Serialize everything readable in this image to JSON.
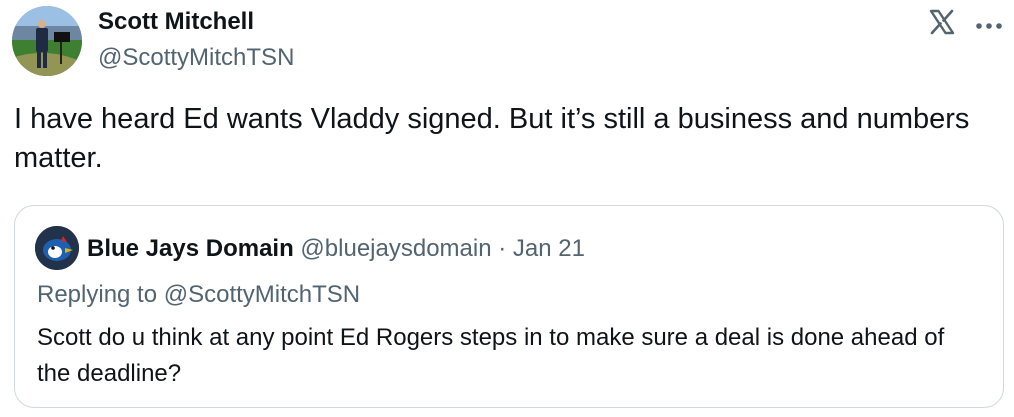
{
  "tweet": {
    "author_name": "Scott Mitchell",
    "author_handle": "@ScottyMitchTSN",
    "text": "I have heard Ed wants Vladdy signed. But it’s still a business and numbers matter.",
    "icons": [
      "avatar",
      "x-logo-icon",
      "more-options-icon"
    ]
  },
  "quote": {
    "author_name": "Blue Jays Domain",
    "author_handle": "@bluejaysdomain",
    "separator": "·",
    "date": "Jan 21",
    "replying_to": "Replying to @ScottyMitchTSN",
    "text": "Scott do u think at any point Ed Rogers steps in to make sure a deal is done ahead of the deadline?",
    "icons": [
      "quote-avatar"
    ]
  },
  "colors": {
    "text_primary": "#0f1419",
    "text_secondary": "#536471",
    "border": "#cfd9de",
    "background": "#ffffff"
  }
}
